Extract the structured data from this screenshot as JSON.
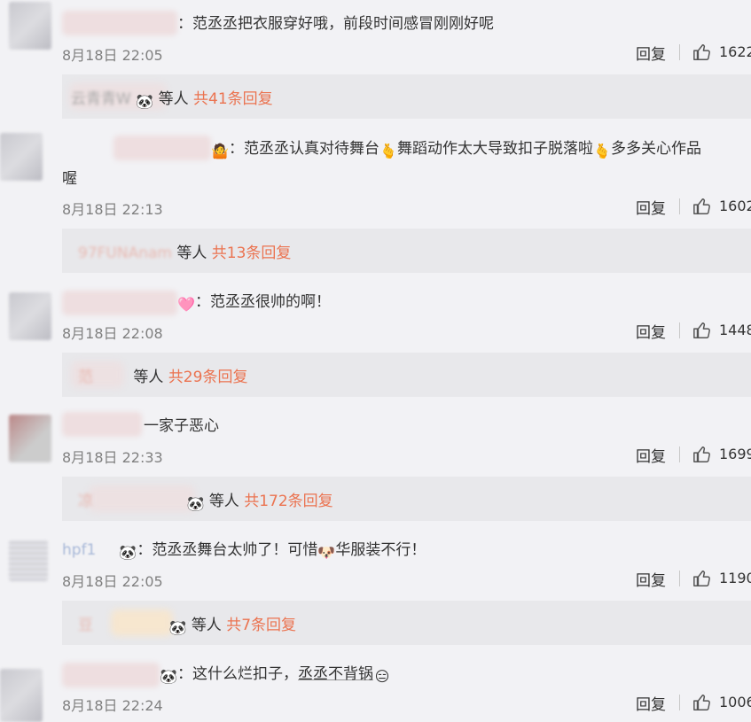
{
  "comments": [
    {
      "prefix_emoji": "",
      "text": "：范丞丞把衣服穿好哦，前段时间感冒刚刚好呢",
      "time": "8月18日 22:05",
      "reply_label": "回复",
      "likes": "1622",
      "reply_bar": {
        "names": "云青青W",
        "emoji": "🐼",
        "suffix": "等人",
        "count_text": "共41条回复"
      }
    },
    {
      "prefix_emoji": "🤷",
      "text": "：范丞丞认真对待舞台",
      "text2": "舞蹈动作太大导致扣子脱落啦",
      "text3": "多多关心作品",
      "text4": "喔",
      "time": "8月18日 22:13",
      "reply_label": "回复",
      "likes": "1602",
      "reply_bar": {
        "names": "97FUNAnam",
        "suffix": "等人",
        "count_text": "共13条回复"
      }
    },
    {
      "prefix_emoji": "🩷",
      "text": "：范丞丞很帅的啊！",
      "time": "8月18日 22:08",
      "reply_label": "回复",
      "likes": "1448",
      "reply_bar": {
        "names": "范",
        "suffix": "等人",
        "count_text": "共29条回复"
      }
    },
    {
      "prefix_emoji": "",
      "text": "一家子恶心",
      "time": "8月18日 22:33",
      "reply_label": "回复",
      "likes": "1699",
      "reply_bar": {
        "names": "凉",
        "emoji": "🐼",
        "suffix": "等人",
        "count_text": "共172条回复"
      }
    },
    {
      "prefix_emoji": "",
      "username": "hpf1",
      "text": "：范丞丞舞台太帅了！可惜",
      "text2": "华服装不行！",
      "time": "8月18日 22:05",
      "reply_label": "回复",
      "likes": "1190",
      "reply_bar": {
        "names": "豆",
        "emoji": "🐼",
        "suffix": "等人",
        "count_text": "共7条回复"
      }
    },
    {
      "prefix_emoji": "🐼",
      "text": "：这什么烂扣子，",
      "text2": "丞丞不背锅",
      "time": "8月18日 22:24",
      "reply_label": "回复",
      "likes": "1006"
    }
  ],
  "icons": {
    "like": "thumbs-up-icon",
    "gesture": "hand-gesture-icon",
    "dog": "dog-emoji-icon",
    "doge": "doge-emoji-icon",
    "panda": "panda-emoji-icon"
  },
  "colors": {
    "accent": "#eb7350",
    "background": "#f2f2f5",
    "reply_bar": "#e8e8eb"
  }
}
